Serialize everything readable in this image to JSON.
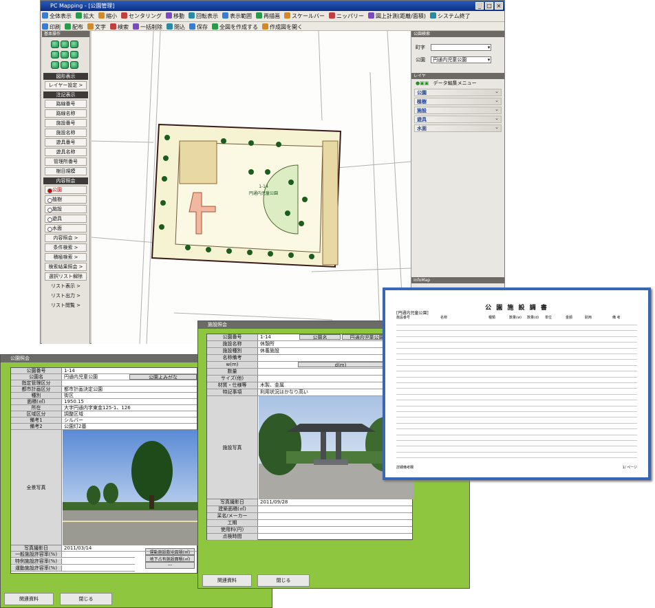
{
  "main_window": {
    "title": "PC Mapping - [公園管理]",
    "toolbar1": [
      "全体表示",
      "拡大",
      "縮小",
      "センタリング",
      "移動",
      "回転表示",
      "表示範囲",
      "再描画",
      "スケールバー",
      "ニッパリー",
      "図上計測(距離/面積)",
      "システム終了"
    ],
    "toolbar2": [
      "印刷",
      "配布",
      "文字",
      "検索",
      "一括削除",
      "閉込",
      "保存",
      "全図を作成する",
      "作成図を開く"
    ],
    "left_panel": {
      "header": "基本操作",
      "sections": [
        {
          "type": "header",
          "label": "図形表示"
        },
        {
          "type": "button",
          "label": "レイヤー設定 >"
        },
        {
          "type": "header",
          "label": "注記表示"
        },
        {
          "type": "button",
          "label": "路線番号"
        },
        {
          "type": "button",
          "label": "路線名称"
        },
        {
          "type": "button",
          "label": "施設番号"
        },
        {
          "type": "button",
          "label": "施設名称"
        },
        {
          "type": "button",
          "label": "遊具番号"
        },
        {
          "type": "button",
          "label": "遊具名称"
        },
        {
          "type": "button",
          "label": "管理所番号"
        },
        {
          "type": "button",
          "label": "樹目規模"
        },
        {
          "type": "header",
          "label": "内容照会"
        },
        {
          "type": "radio",
          "label": "公園",
          "selected": true
        },
        {
          "type": "radio",
          "label": "植樹",
          "selected": false
        },
        {
          "type": "radio",
          "label": "施設",
          "selected": false
        },
        {
          "type": "radio",
          "label": "遊具",
          "selected": false
        },
        {
          "type": "radio",
          "label": "水面",
          "selected": false
        },
        {
          "type": "button",
          "label": "内容照会 >"
        },
        {
          "type": "button",
          "label": "条件検索 >"
        },
        {
          "type": "button",
          "label": "積極検索 >"
        },
        {
          "type": "button",
          "label": "検索結果照会 >"
        },
        {
          "type": "button",
          "label": "選択リスト解除"
        },
        {
          "type": "plain",
          "label": "リスト表示 >"
        },
        {
          "type": "plain",
          "label": "リスト出力 >"
        },
        {
          "type": "plain",
          "label": "リスト閲覧 >"
        }
      ]
    },
    "map": {
      "park_id": "1-14",
      "park_name": "円通内児童公園"
    },
    "right_panel": {
      "header1": "公園検索",
      "machi_label": "町字",
      "machi_value": "",
      "park_label": "公園",
      "park_value": "円通内児童公園",
      "header2": "レイヤ",
      "menu_label": "データ編集メニュー",
      "layers": [
        "公園",
        "植樹",
        "施設",
        "遊具",
        "水面"
      ],
      "header3": "InfoMap"
    }
  },
  "park_dialog": {
    "title": "公園照会",
    "fields": [
      {
        "label": "公園番号",
        "value": "1-14"
      },
      {
        "label": "公園名",
        "value": "円通内児童公園",
        "extra": "公園よみがな"
      },
      {
        "label": "指定管理区分",
        "value": ""
      },
      {
        "label": "都市計画区分",
        "value": "都市計画決定公園"
      },
      {
        "label": "種別",
        "value": "街区"
      },
      {
        "label": "面積(㎡)",
        "value": "1950.15"
      },
      {
        "label": "所在",
        "value": "大字円通内字東金125-1、126"
      },
      {
        "label": "区域区分",
        "value": "調整区域"
      },
      {
        "label": "備考1",
        "value": "シルバー"
      },
      {
        "label": "備考2",
        "value": "公園灯2基"
      }
    ],
    "photo_label": "全景写真",
    "photo_date_label": "写真撮影日",
    "photo_date": "2011/03/14",
    "ratios": [
      {
        "label": "一般施設許容率(%)",
        "extra": "運動施設敷地面積(㎡)"
      },
      {
        "label": "特例施設許容率(%)",
        "extra": "地下占有施設面積(㎡)"
      },
      {
        "label": "運動施設許容率(%)",
        "extra": "---"
      }
    ],
    "btn_related": "関連資料",
    "btn_close": "閉じる"
  },
  "facility_dialog": {
    "title": "施設照会",
    "fields": [
      {
        "label": "公園番号",
        "value": "1-14",
        "extra": "公園名",
        "extra2": "円通内児童公園"
      },
      {
        "label": "施設名称",
        "value": "休憩所"
      },
      {
        "label": "施設種別",
        "value": "休養施設"
      },
      {
        "label": "名称備考",
        "value": ""
      },
      {
        "label": "w(m)",
        "value": "",
        "extra": "d(m)"
      },
      {
        "label": "数量",
        "value": ""
      },
      {
        "label": "サイズ(他)",
        "value": ""
      },
      {
        "label": "材質・仕様等",
        "value": "木製、金属"
      },
      {
        "label": "特記事項",
        "value": "利用状況はかなり高い"
      }
    ],
    "photo_label": "施設写真",
    "rows_after": [
      {
        "label": "写真撮影日",
        "value": "2011/09/28"
      },
      {
        "label": "建築面積(㎡)",
        "value": ""
      },
      {
        "label": "呆名/メーカー",
        "value": ""
      },
      {
        "label": "工期",
        "value": ""
      },
      {
        "label": "使用料(円)",
        "value": ""
      },
      {
        "label": "点検時間",
        "value": ""
      }
    ],
    "btn_related": "関連資料",
    "btn_close": "閉じる"
  },
  "report": {
    "title": "公 園 施 設 調 書",
    "subtitle": "[円通内児童公園]",
    "columns": [
      "施設番号",
      "名称",
      "種類",
      "数量(w)",
      "数量(d)",
      "単位",
      "金額",
      "耐用",
      "備 考"
    ],
    "footer_left": "詳細備考欄",
    "footer_right": "1/ ページ"
  }
}
